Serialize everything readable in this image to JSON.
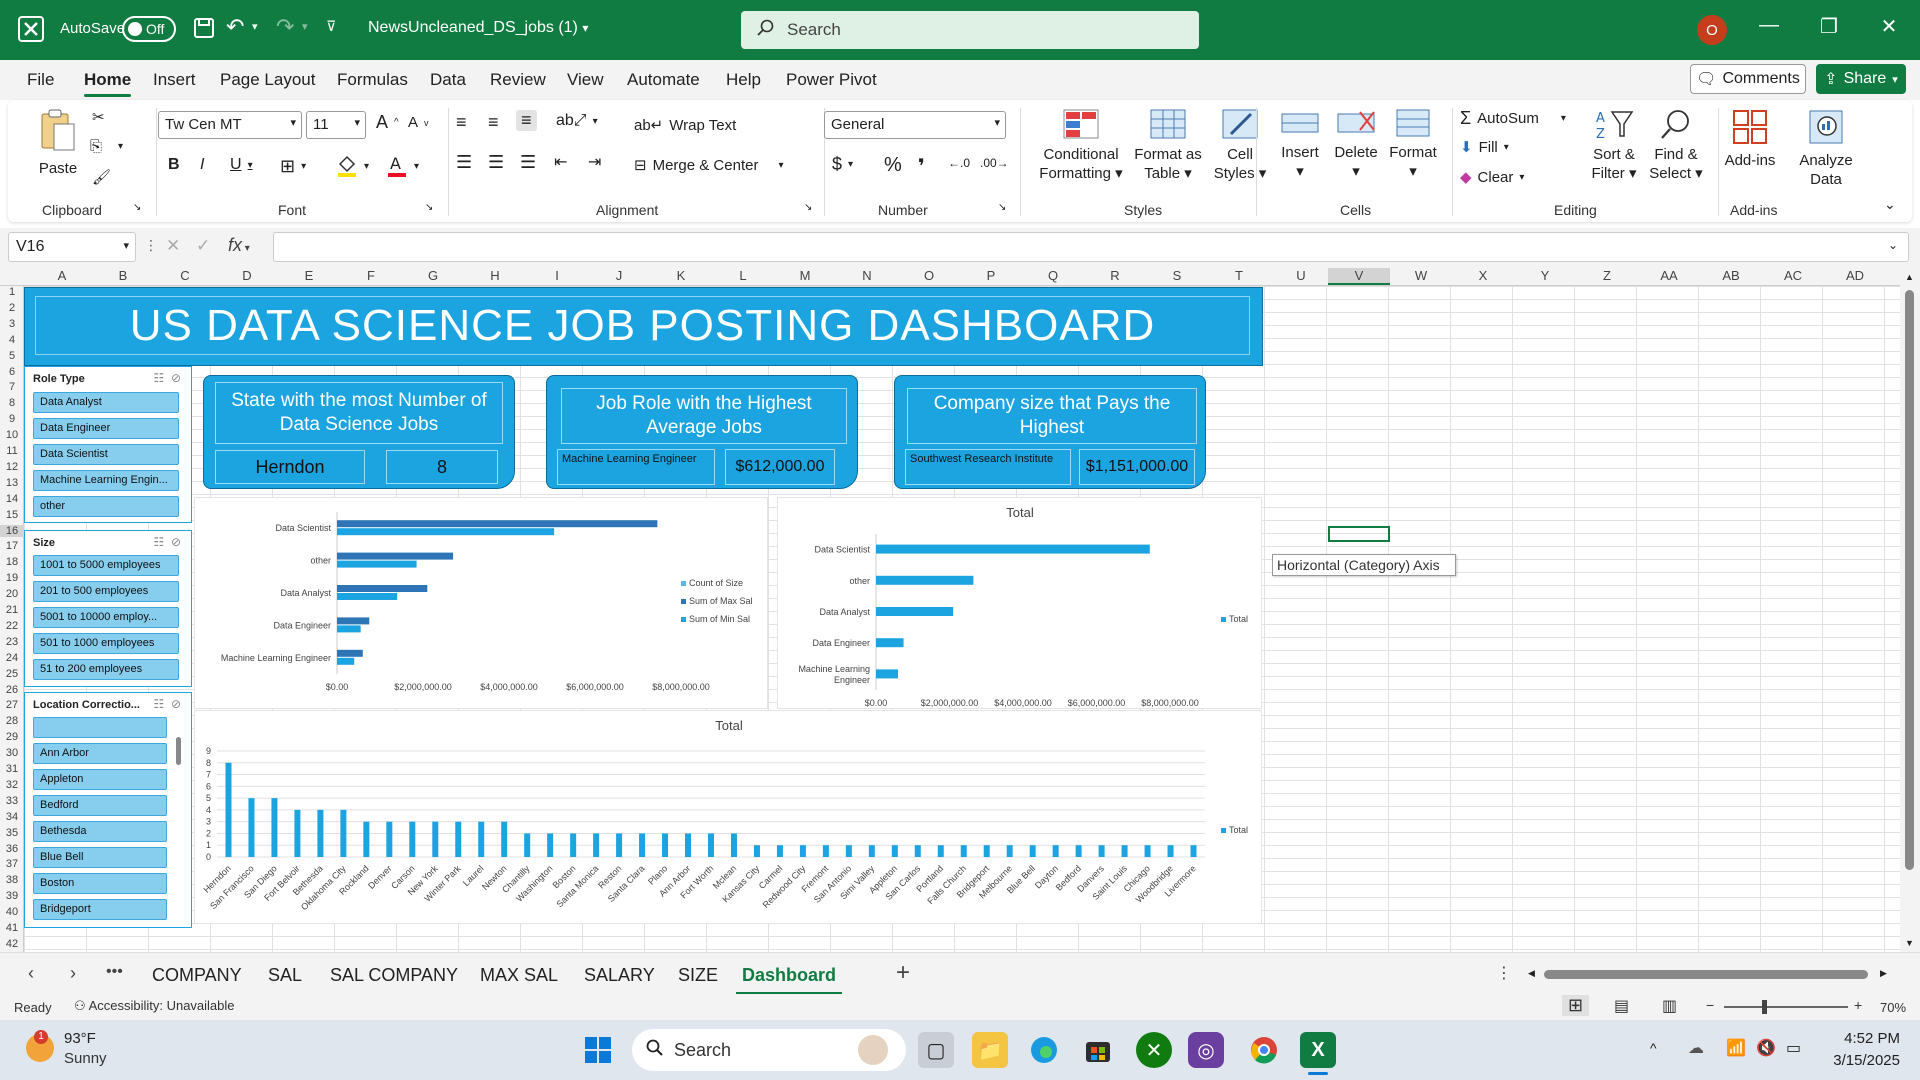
{
  "titlebar": {
    "autosave_label": "AutoSave",
    "autosave_state": "Off",
    "filename": "NewsUncleaned_DS_jobs (1)",
    "search_placeholder": "Search",
    "avatar_letter": "O"
  },
  "menu": {
    "tabs": [
      "File",
      "Home",
      "Insert",
      "Page Layout",
      "Formulas",
      "Data",
      "Review",
      "View",
      "Automate",
      "Help",
      "Power Pivot"
    ],
    "active": "Home",
    "comments": "Comments",
    "share": "Share"
  },
  "ribbon": {
    "clipboard": {
      "label": "Clipboard",
      "paste": "Paste"
    },
    "font": {
      "label": "Font",
      "name": "Tw Cen MT",
      "size": "11"
    },
    "alignment": {
      "label": "Alignment",
      "wrap": "Wrap Text",
      "merge": "Merge & Center"
    },
    "number": {
      "label": "Number",
      "format": "General"
    },
    "styles": {
      "label": "Styles",
      "cond_1": "Conditional",
      "cond_2": "Formatting",
      "table_1": "Format as",
      "table_2": "Table",
      "cell_1": "Cell",
      "cell_2": "Styles"
    },
    "cells": {
      "label": "Cells",
      "insert": "Insert",
      "delete": "Delete",
      "format": "Format"
    },
    "editing": {
      "label": "Editing",
      "autosum": "AutoSum",
      "fill": "Fill",
      "clear": "Clear",
      "sort_1": "Sort &",
      "sort_2": "Filter",
      "find_1": "Find &",
      "find_2": "Select"
    },
    "addins": {
      "label": "Add-ins",
      "addins": "Add-ins",
      "analyze_1": "Analyze",
      "analyze_2": "Data"
    }
  },
  "formula_bar": {
    "namebox": "V16",
    "fx": "fx",
    "value": ""
  },
  "columns": [
    "A",
    "B",
    "C",
    "D",
    "E",
    "F",
    "G",
    "H",
    "I",
    "J",
    "K",
    "L",
    "M",
    "N",
    "O",
    "P",
    "Q",
    "R",
    "S",
    "T",
    "U",
    "V",
    "W",
    "X",
    "Y",
    "Z",
    "AA",
    "AB",
    "AC",
    "AD"
  ],
  "rows": [
    "1",
    "2",
    "3",
    "4",
    "5",
    "6",
    "7",
    "8",
    "9",
    "10",
    "11",
    "12",
    "13",
    "14",
    "15",
    "16",
    "17",
    "18",
    "19",
    "20",
    "21",
    "22",
    "23",
    "24",
    "25",
    "26",
    "27",
    "28",
    "29",
    "30",
    "31",
    "32",
    "33",
    "34",
    "35",
    "36",
    "37",
    "38",
    "39",
    "40",
    "41",
    "42"
  ],
  "dashboard": {
    "title": "US DATA SCIENCE  JOB POSTING DASHBOARD",
    "slicers": [
      {
        "header": "Role Type",
        "items": [
          "Data Analyst",
          "Data Engineer",
          "Data Scientist",
          "Machine Learning Engin...",
          "other"
        ]
      },
      {
        "header": "Size",
        "items": [
          "1001 to 5000 employees",
          "201 to 500 employees",
          "5001 to 10000 employ...",
          "501 to 1000 employees",
          "51 to 200 employees"
        ]
      },
      {
        "header": "Location Correctio...",
        "items": [
          "",
          "Ann Arbor",
          "Appleton",
          "Bedford",
          "Bethesda",
          "Blue Bell",
          "Boston",
          "Bridgeport"
        ]
      }
    ],
    "kpis": [
      {
        "header": "State with the most Number of Data Science Jobs",
        "values": [
          "Herndon",
          "8"
        ]
      },
      {
        "header": "Job Role with the Highest Average Jobs",
        "values": [
          "Machine Learning Engineer",
          "$612,000.00"
        ]
      },
      {
        "header": "Company size that Pays the Highest",
        "values": [
          "Southwest Research Institute",
          "$1,151,000.00"
        ]
      }
    ],
    "tooltip": "Horizontal (Category) Axis"
  },
  "chart_data": [
    {
      "type": "bar",
      "orientation": "horizontal",
      "title": "",
      "categories": [
        "Data Scientist",
        "other",
        "Data Analyst",
        "Data Engineer",
        "Machine Learning Engineer"
      ],
      "series": [
        {
          "name": "Count of Size",
          "values": [
            null,
            null,
            null,
            null,
            null
          ]
        },
        {
          "name": "Sum of Max Sal",
          "values": [
            7450000,
            2700000,
            2100000,
            750000,
            600000
          ]
        },
        {
          "name": "Sum of Min Sal",
          "values": [
            5050000,
            1850000,
            1400000,
            550000,
            400000
          ]
        }
      ],
      "xticks": [
        "$0.00",
        "$2,000,000.00",
        "$4,000,000.00",
        "$6,000,000.00",
        "$8,000,000.00"
      ],
      "xlim": [
        0,
        8000000
      ],
      "legend": "right",
      "colors": [
        "#5ab8e6",
        "#2e75b6",
        "#1ba4e0"
      ]
    },
    {
      "type": "bar",
      "orientation": "horizontal",
      "title": "Total",
      "categories": [
        "Data Scientist",
        "other",
        "Data Analyst",
        "Data Engineer",
        "Machine Learning Engineer"
      ],
      "series": [
        {
          "name": "Total",
          "values": [
            7450000,
            2650000,
            2100000,
            750000,
            600000
          ]
        }
      ],
      "xticks": [
        "$0.00",
        "$2,000,000.00",
        "$4,000,000.00",
        "$6,000,000.00",
        "$8,000,000.00"
      ],
      "xlim": [
        0,
        8000000
      ],
      "legend": "right",
      "colors": [
        "#1ba4e0"
      ]
    },
    {
      "type": "bar",
      "orientation": "vertical",
      "title": "Total",
      "categories": [
        "Herndon",
        "San Francisco",
        "San Diego",
        "Fort Belvoir",
        "Bethesda",
        "Oklahoma City",
        "Rockland",
        "Denver",
        "Carson",
        "New York",
        "Winter Park",
        "Laurel",
        "Newton",
        "Chantilly",
        "Washington",
        "Boston",
        "Santa Monica",
        "Reston",
        "Santa Clara",
        "Plano",
        "Ann Arbor",
        "Fort Worth",
        "Mclean",
        "Kansas City",
        "Carmel",
        "Redwood City",
        "Fremont",
        "San Antonio",
        "Simi Valley",
        "Appleton",
        "San Carlos",
        "Portland",
        "Falls Church",
        "Bridgeport",
        "Melbourne",
        "Blue Bell",
        "Dayton",
        "Bedford",
        "Danvers",
        "Saint Louis",
        "Chicago",
        "Woodbridge",
        "Livermore"
      ],
      "series": [
        {
          "name": "Total",
          "values": [
            8,
            5,
            5,
            4,
            4,
            4,
            3,
            3,
            3,
            3,
            3,
            3,
            3,
            2,
            2,
            2,
            2,
            2,
            2,
            2,
            2,
            2,
            2,
            1,
            1,
            1,
            1,
            1,
            1,
            1,
            1,
            1,
            1,
            1,
            1,
            1,
            1,
            1,
            1,
            1,
            1,
            1,
            1
          ]
        }
      ],
      "ylim": [
        0,
        9
      ],
      "yticks": [
        "0",
        "1",
        "2",
        "3",
        "4",
        "5",
        "6",
        "7",
        "8",
        "9"
      ],
      "legend": "right",
      "colors": [
        "#1ba4e0"
      ]
    }
  ],
  "sheets": {
    "tabs": [
      "COMPANY",
      "SAL",
      "SAL COMPANY",
      "MAX SAL",
      "SALARY",
      "SIZE",
      "Dashboard"
    ],
    "active": "Dashboard"
  },
  "status": {
    "ready": "Ready",
    "accessibility": "Accessibility: Unavailable",
    "zoom": "70%"
  },
  "taskbar": {
    "temp": "93°F",
    "weather": "Sunny",
    "search": "Search",
    "time": "4:52 PM",
    "date": "3/15/2025",
    "badge": "1"
  }
}
